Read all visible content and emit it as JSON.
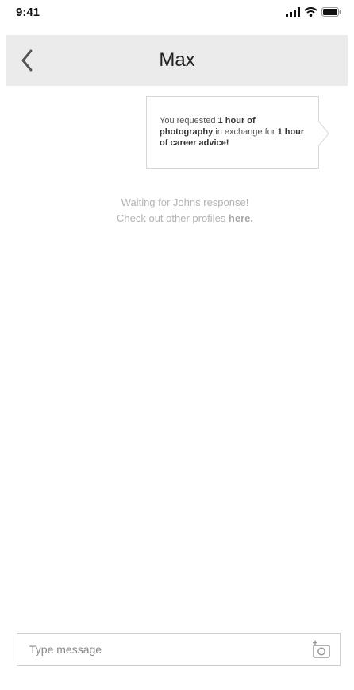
{
  "status_bar": {
    "time": "9:41",
    "icons": [
      "signal-icon",
      "wifi-icon",
      "battery-icon"
    ]
  },
  "header": {
    "back_icon": "chevron-left-icon",
    "title": "Max"
  },
  "request_card": {
    "prefix": "You requested ",
    "offer": "1 hour of photography",
    "middle": " in exchange for ",
    "request": "1 hour of career advice!"
  },
  "status_message": {
    "line1": "Waiting for Johns response!",
    "line2_prefix": "Check out other profiles ",
    "link_text": "here."
  },
  "composer": {
    "placeholder": "Type message",
    "value": "",
    "attach_icon": "add-photo-icon"
  },
  "colors": {
    "header_bg": "#ebebeb",
    "muted_text": "#b3b3b3",
    "border": "#d6d6d6"
  }
}
